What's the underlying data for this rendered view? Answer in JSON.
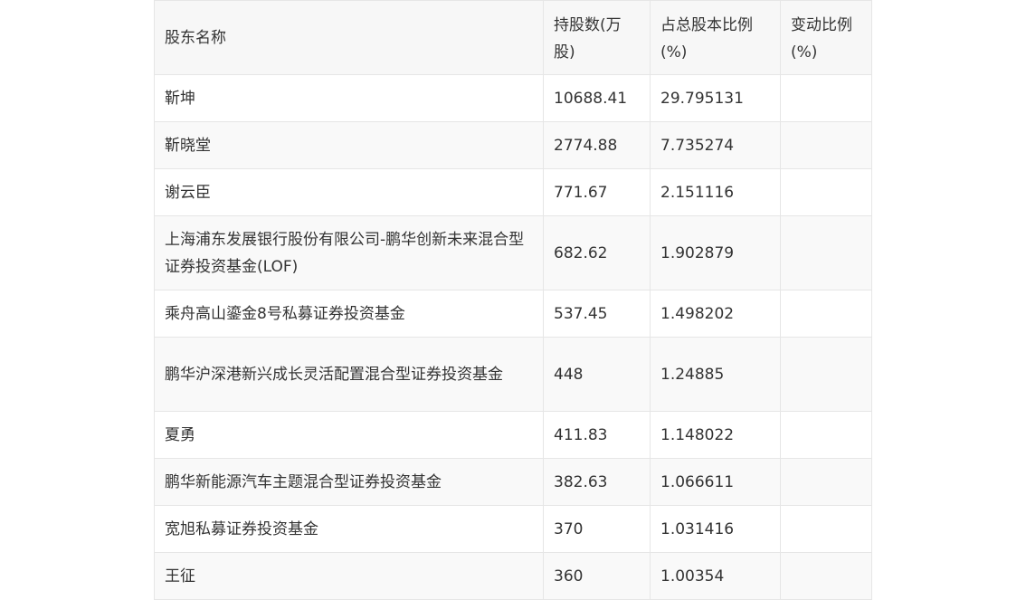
{
  "table": {
    "headers": [
      "股东名称",
      "持股数(万股)",
      "占总股本比例(%)",
      "变动比例(%)"
    ],
    "rows": [
      {
        "name": "靳坤",
        "shares": "10688.41",
        "ratio": "29.795131",
        "change": ""
      },
      {
        "name": "靳晓堂",
        "shares": "2774.88",
        "ratio": "7.735274",
        "change": ""
      },
      {
        "name": "谢云臣",
        "shares": "771.67",
        "ratio": "2.151116",
        "change": ""
      },
      {
        "name": "上海浦东发展银行股份有限公司-鹏华创新未来混合型证券投资基金(LOF)",
        "shares": "682.62",
        "ratio": "1.902879",
        "change": ""
      },
      {
        "name": "乘舟高山鎏金8号私募证券投资基金",
        "shares": "537.45",
        "ratio": "1.498202",
        "change": ""
      },
      {
        "name": "鹏华沪深港新兴成长灵活配置混合型证券投资基金",
        "shares": "448",
        "ratio": "1.24885",
        "change": ""
      },
      {
        "name": "夏勇",
        "shares": "411.83",
        "ratio": "1.148022",
        "change": ""
      },
      {
        "name": "鹏华新能源汽车主题混合型证券投资基金",
        "shares": "382.63",
        "ratio": "1.066611",
        "change": ""
      },
      {
        "name": "宽旭私募证券投资基金",
        "shares": "370",
        "ratio": "1.031416",
        "change": ""
      },
      {
        "name": "王征",
        "shares": "360",
        "ratio": "1.00354",
        "change": ""
      }
    ]
  }
}
